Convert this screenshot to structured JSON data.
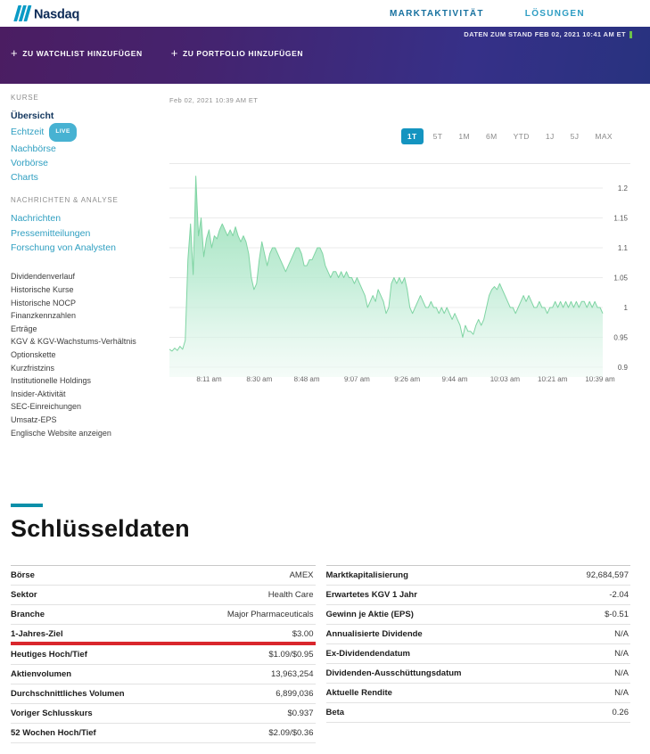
{
  "header": {
    "brand": "Nasdaq",
    "nav": [
      {
        "label": "MARKTAKTIVITÄT"
      },
      {
        "label": "LÖSUNGEN"
      }
    ]
  },
  "banner": {
    "as_of": "DATEN ZUM STAND FEB 02, 2021 10:41 AM ET",
    "actions": [
      {
        "label": "ZU WATCHLIST HINZUFÜGEN"
      },
      {
        "label": "ZU PORTFOLIO HINZUFÜGEN"
      }
    ]
  },
  "sidebar": {
    "sections": [
      {
        "title": "KURSE",
        "items": [
          {
            "label": "Übersicht",
            "active": true
          },
          {
            "label": "Echtzeit",
            "badge": "LIVE"
          },
          {
            "label": "Nachbörse"
          },
          {
            "label": "Vorbörse"
          },
          {
            "label": "Charts"
          }
        ]
      },
      {
        "title": "NACHRICHTEN & ANALYSE",
        "items": [
          {
            "label": "Nachrichten"
          },
          {
            "label": "Pressemitteilungen"
          },
          {
            "label": "Forschung von Analysten"
          }
        ]
      }
    ],
    "links": [
      "Dividendenverlauf",
      "Historische Kurse",
      "Historische NOCP",
      "Finanzkennzahlen",
      "Erträge",
      "KGV & KGV-Wachstums-Verhältnis",
      "Optionskette",
      "Kurzfristzins",
      "Institutionelle Holdings",
      "Insider-Aktivität",
      "SEC-Einreichungen",
      "Umsatz-EPS",
      "Englische Website anzeigen"
    ]
  },
  "chart": {
    "timestamp": "Feb 02, 2021 10:39 AM ET",
    "ranges": [
      "1T",
      "5T",
      "1M",
      "6M",
      "YTD",
      "1J",
      "5J",
      "MAX"
    ],
    "active_range": "1T"
  },
  "chart_data": {
    "type": "area",
    "title": "",
    "xlabel": "",
    "ylabel": "",
    "x_start": "7:56 am",
    "x_end": "10:40 am",
    "interval_minutes": 1,
    "ylim": [
      0.9,
      1.225
    ],
    "y_axis_side": "right",
    "grid": true,
    "y_ticks": [
      1.2,
      1.15,
      1.1,
      1.05,
      1,
      0.95,
      0.9
    ],
    "y_tick_labels": [
      "1.2",
      "1.15",
      "1.1",
      "1.05",
      "1",
      "0.95",
      "0.9"
    ],
    "x_tick_labels": [
      "8:11 am",
      "8:30 am",
      "8:48 am",
      "9:07 am",
      "9:26 am",
      "9:44 am",
      "10:03 am",
      "10:21 am",
      "10:39 am"
    ],
    "x_tick_offsets_min": [
      15,
      34,
      52,
      71,
      90,
      108,
      127,
      145,
      163
    ],
    "fill_top_color": "#8adbab",
    "fill_bottom_color": "#edf9f3",
    "line_color": "#7fd4a3",
    "values": [
      0.93,
      0.927,
      0.932,
      0.928,
      0.935,
      0.93,
      0.945,
      1.08,
      1.14,
      1.055,
      1.22,
      1.12,
      1.15,
      1.085,
      1.115,
      1.13,
      1.1,
      1.12,
      1.115,
      1.13,
      1.14,
      1.13,
      1.12,
      1.13,
      1.12,
      1.135,
      1.12,
      1.11,
      1.12,
      1.11,
      1.09,
      1.05,
      1.03,
      1.04,
      1.08,
      1.11,
      1.09,
      1.07,
      1.09,
      1.1,
      1.1,
      1.09,
      1.08,
      1.07,
      1.06,
      1.07,
      1.08,
      1.09,
      1.1,
      1.1,
      1.09,
      1.07,
      1.07,
      1.08,
      1.08,
      1.09,
      1.1,
      1.1,
      1.09,
      1.07,
      1.06,
      1.05,
      1.06,
      1.06,
      1.05,
      1.06,
      1.05,
      1.06,
      1.05,
      1.05,
      1.04,
      1.05,
      1.04,
      1.03,
      1.02,
      1.0,
      1.01,
      1.02,
      1.01,
      1.03,
      1.02,
      1.01,
      0.99,
      1.0,
      1.04,
      1.05,
      1.04,
      1.05,
      1.04,
      1.05,
      1.03,
      1.0,
      0.99,
      1.0,
      1.01,
      1.02,
      1.01,
      1.0,
      1.0,
      1.01,
      1.0,
      1.0,
      0.99,
      1.0,
      0.99,
      1.0,
      0.99,
      0.98,
      0.99,
      0.98,
      0.97,
      0.95,
      0.97,
      0.96,
      0.96,
      0.955,
      0.97,
      0.98,
      0.97,
      0.98,
      1.0,
      1.02,
      1.03,
      1.035,
      1.03,
      1.04,
      1.03,
      1.02,
      1.01,
      1.0,
      1.0,
      0.99,
      1.0,
      1.01,
      1.02,
      1.01,
      1.02,
      1.01,
      1.0,
      1.0,
      1.01,
      1.0,
      1.0,
      0.99,
      1.0,
      1.0,
      1.01,
      1.0,
      1.01,
      1.0,
      1.01,
      1.0,
      1.01,
      1.0,
      1.01,
      1.0,
      1.01,
      1.01,
      1.0,
      1.01,
      1.0,
      1.01,
      1.0,
      1.0,
      0.99
    ]
  },
  "key_data": {
    "title": "Schlüsseldaten",
    "left_rows": [
      {
        "label": "Börse",
        "value": "AMEX"
      },
      {
        "label": "Sektor",
        "value": "Health Care"
      },
      {
        "label": "Branche",
        "value": "Major Pharmaceuticals"
      },
      {
        "label": "1-Jahres-Ziel",
        "value": "$3.00",
        "highlight": true
      },
      {
        "label": "Heutiges Hoch/Tief",
        "value": "$1.09/$0.95"
      },
      {
        "label": "Aktienvolumen",
        "value": "13,963,254"
      },
      {
        "label": "Durchschnittliches Volumen",
        "value": "6,899,036"
      },
      {
        "label": "Voriger Schlusskurs",
        "value": "$0.937"
      },
      {
        "label": "52 Wochen Hoch/Tief",
        "value": "$2.09/$0.36"
      }
    ],
    "right_rows": [
      {
        "label": "Marktkapitalisierung",
        "value": "92,684,597"
      },
      {
        "label": "Erwartetes KGV 1 Jahr",
        "value": "-2.04"
      },
      {
        "label": "Gewinn je Aktie (EPS)",
        "value": "$-0.51"
      },
      {
        "label": "Annualisierte Dividende",
        "value": "N/A"
      },
      {
        "label": "Ex-Dividendendatum",
        "value": "N/A"
      },
      {
        "label": "Dividenden-Ausschüttungsdatum",
        "value": "N/A"
      },
      {
        "label": "Aktuelle Rendite",
        "value": "N/A"
      },
      {
        "label": "Beta",
        "value": "0.26"
      }
    ]
  },
  "colors": {
    "accent_teal": "#0b8fa9",
    "active_range_bg": "#1494c0",
    "banner_purple_left": "#4b1d62",
    "banner_blue_right": "#28327f",
    "live_badge": "#47b2d2",
    "highlight_red": "#d9262c",
    "chart_green": "#8adbab",
    "live_tick_green": "#6cc04a",
    "logo_blue": "#0a9bc6",
    "brand_navy": "#0c2a56"
  }
}
